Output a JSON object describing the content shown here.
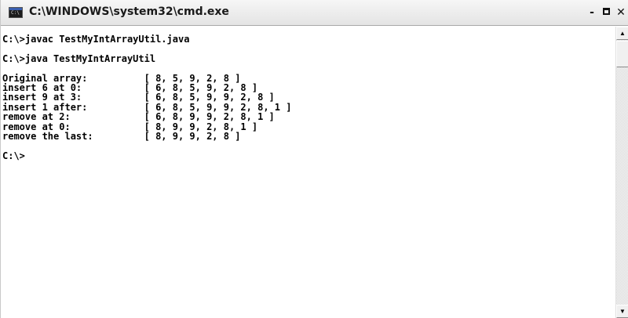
{
  "window": {
    "title": "C:\\WINDOWS\\system32\\cmd.exe",
    "icon": "cmd-icon",
    "controls": {
      "minimize": "-",
      "close": "✕"
    }
  },
  "console": {
    "lines": [
      "C:\\>javac TestMyIntArrayUtil.java",
      "",
      "C:\\>java TestMyIntArrayUtil",
      "",
      "Original array:          [ 8, 5, 9, 2, 8 ]",
      "insert 6 at 0:           [ 6, 8, 5, 9, 2, 8 ]",
      "insert 9 at 3:           [ 6, 8, 5, 9, 9, 2, 8 ]",
      "insert 1 after:          [ 6, 8, 5, 9, 9, 2, 8, 1 ]",
      "remove at 2:             [ 6, 8, 9, 9, 2, 8, 1 ]",
      "remove at 0:             [ 8, 9, 9, 2, 8, 1 ]",
      "remove the last:         [ 8, 9, 9, 2, 8 ]",
      "",
      "C:\\>"
    ]
  },
  "scrollbar": {
    "up_arrow": "▲",
    "down_arrow": "▼"
  }
}
